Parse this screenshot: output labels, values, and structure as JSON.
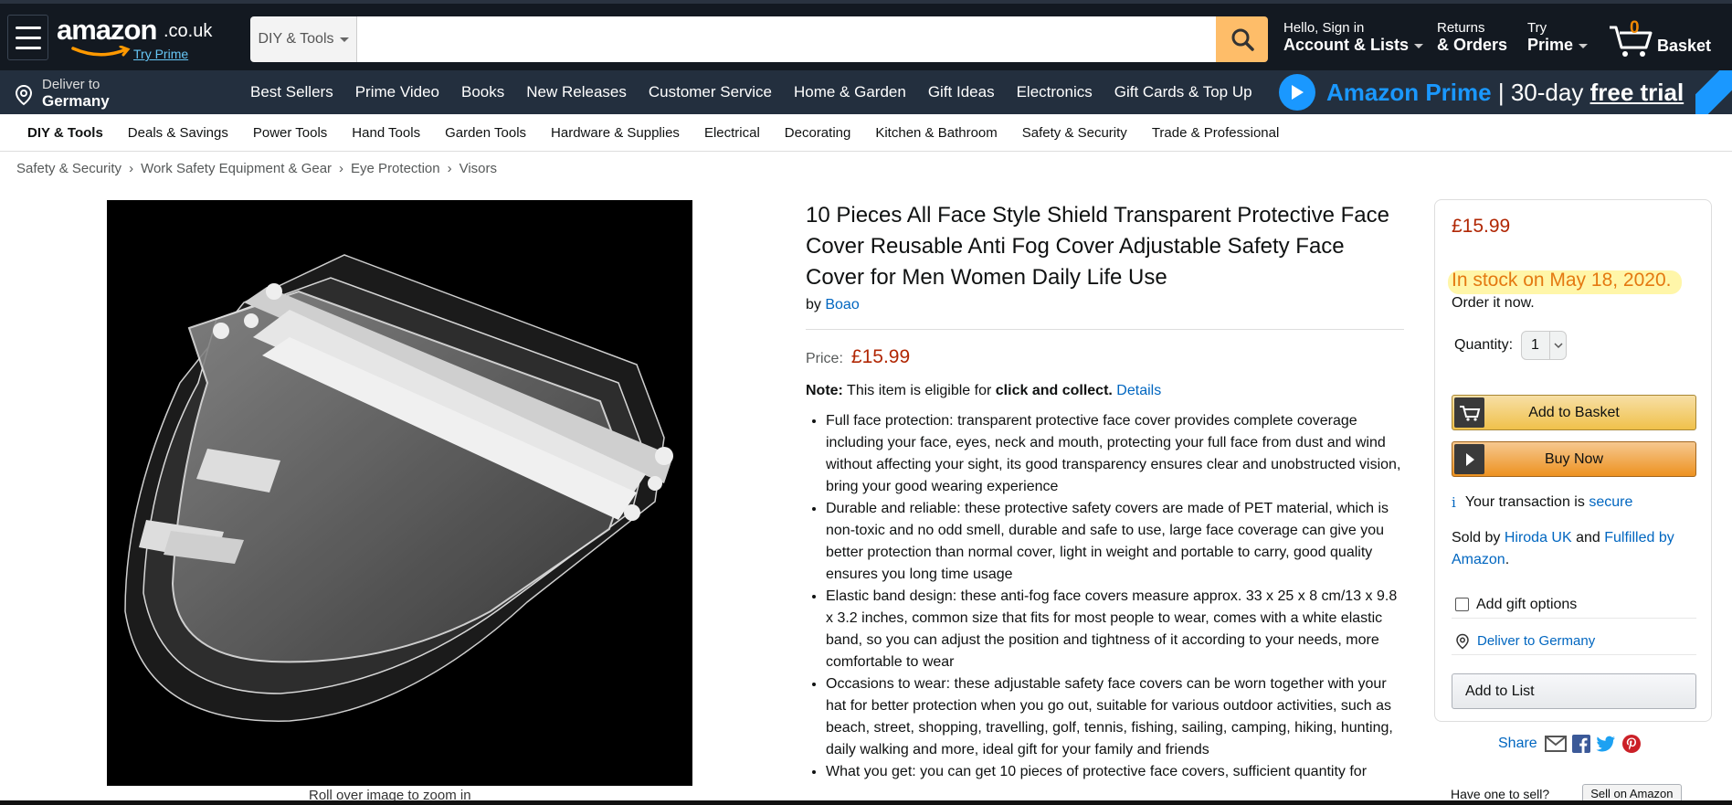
{
  "header": {
    "logo_text": "amazon",
    "logo_tld": ".co.uk",
    "try_prime": "Try Prime",
    "search_category": "DIY & Tools",
    "search_value": "",
    "account_small": "Hello, Sign in",
    "account_big": "Account & Lists",
    "returns_small": "Returns",
    "returns_big": "& Orders",
    "prime_small": "Try",
    "prime_big": "Prime",
    "basket_count": "0",
    "basket_label": "Basket"
  },
  "nav": {
    "deliver_small": "Deliver to",
    "deliver_big": "Germany",
    "links": [
      "Best Sellers",
      "Prime Video",
      "Books",
      "New Releases",
      "Customer Service",
      "Home & Garden",
      "Gift Ideas",
      "Electronics",
      "Gift Cards & Top Up"
    ],
    "prime_banner": {
      "brand": "Amazon Prime",
      "sep": "|",
      "offer": "30-day",
      "free": "free trial"
    }
  },
  "subnav": [
    "DIY & Tools",
    "Deals & Savings",
    "Power Tools",
    "Hand Tools",
    "Garden Tools",
    "Hardware & Supplies",
    "Electrical",
    "Decorating",
    "Kitchen & Bathroom",
    "Safety & Security",
    "Trade & Professional"
  ],
  "breadcrumb": [
    "Safety & Security",
    "Work Safety Equipment & Gear",
    "Eye Protection",
    "Visors"
  ],
  "breadcrumb_sep": "›",
  "image": {
    "zoom_hint": "Roll over image to zoom in"
  },
  "product": {
    "title": "10 Pieces All Face Style Shield Transparent Protective Face Cover Reusable Anti Fog Cover Adjustable Safety Face Cover for Men Women Daily Life Use",
    "by": "by",
    "brand": "Boao",
    "price_label": "Price:",
    "price": "£15.99",
    "note_label": "Note:",
    "note_text": "This item is eligible for",
    "note_bold": "click and collect.",
    "note_link": "Details",
    "bullets": [
      "Full face protection: transparent protective face cover provides complete coverage including your face, eyes, neck and mouth, protecting your full face from dust and wind without affecting your sight, its good transparency ensures clear and unobstructed vision, bring your good wearing experience",
      "Durable and reliable: these protective safety covers are made of PET material, which is non-toxic and no odd smell, durable and safe to use, large face coverage can give you better protection than normal cover, light in weight and portable to carry, good quality ensures you long time usage",
      "Elastic band design: these anti-fog face covers measure approx. 33 x 25 x 8 cm/13 x 9.8 x 3.2 inches, common size that fits for most people to wear, comes with a white elastic band, so you can adjust the position and tightness of it according to your needs, more comfortable to wear",
      "Occasions to wear: these adjustable safety face covers can be worn together with your hat for better protection when you go out, suitable for various outdoor activities, such as beach, street, shopping, travelling, golf, tennis, fishing, sailing, camping, hiking, hunting, daily walking and more, ideal gift for your family and friends",
      "What you get: you can get 10 pieces of protective face covers, sufficient quantity for"
    ]
  },
  "buybox": {
    "price": "£15.99",
    "stock": "In stock on May 18, 2020.",
    "order": "Order it now.",
    "qty_label": "Quantity:",
    "qty_value": "1",
    "add_to_basket": "Add to Basket",
    "buy_now": "Buy Now",
    "secure_text": "Your transaction is",
    "secure_link": "secure",
    "sold_by_label": "Sold by",
    "seller": "Hiroda UK",
    "and": "and",
    "fulfilled": "Fulfilled by Amazon",
    "period": ".",
    "gift": "Add gift options",
    "deliver": "Deliver to Germany",
    "add_to_list": "Add to List"
  },
  "share": {
    "label": "Share"
  },
  "sell": {
    "question": "Have one to sell?",
    "button": "Sell on Amazon"
  },
  "colors": {
    "nav_dark": "#131921",
    "nav_mid": "#232f3e",
    "price": "#b12704",
    "link": "#0066c0",
    "stock": "#e47911",
    "search_btn": "#febd69",
    "prime_blue": "#1a98ff"
  }
}
